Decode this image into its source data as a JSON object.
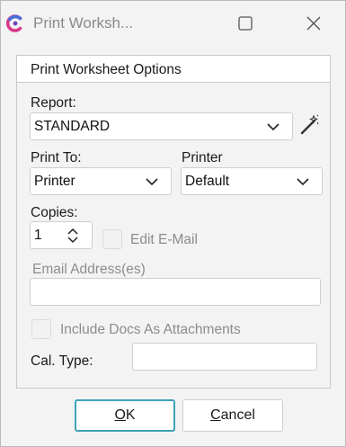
{
  "window": {
    "title": "Print Worksh...",
    "brand_color": "#d93a8a",
    "accent_color": "#3fa2b8"
  },
  "group": {
    "title": "Print Worksheet Options"
  },
  "report": {
    "label": "Report:",
    "value": "STANDARD",
    "icon": "magic-wand-icon"
  },
  "print_to": {
    "label": "Print To:",
    "value": "Printer"
  },
  "printer": {
    "label": "Printer",
    "value": "Default"
  },
  "copies": {
    "label": "Copies:",
    "value": "1"
  },
  "edit_email": {
    "label": "Edit E-Mail",
    "checked": false,
    "enabled": false
  },
  "email_address": {
    "label": "Email Address(es)",
    "value": ""
  },
  "include_docs": {
    "label": "Include Docs As Attachments",
    "checked": false,
    "enabled": false
  },
  "cal_type": {
    "label": "Cal. Type:",
    "value": ""
  },
  "buttons": {
    "ok_mnemonic": "O",
    "ok_rest": "K",
    "cancel_mnemonic": "C",
    "cancel_rest": "ancel"
  }
}
